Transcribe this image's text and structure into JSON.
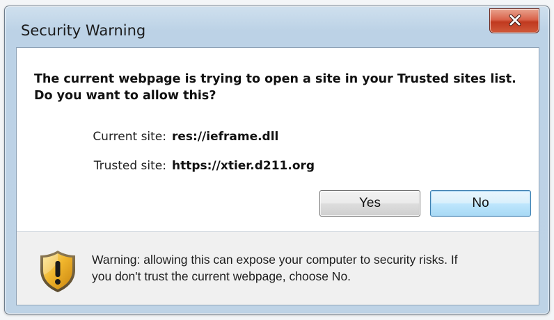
{
  "window": {
    "title": "Security Warning"
  },
  "message": {
    "line1": "The current webpage is trying to open a site in your Trusted sites list.",
    "line2": "Do you want to allow this?"
  },
  "sites": {
    "current_label": "Current site:",
    "current_value": "res://ieframe.dll",
    "trusted_label": "Trusted site:",
    "trusted_value": "https://xtier.d211.org"
  },
  "buttons": {
    "yes_label": "Yes",
    "no_label": "No",
    "default": "No"
  },
  "warning": {
    "icon": "shield-warning-icon",
    "line1": "Warning: allowing this can expose your computer to security risks. If",
    "line2": "you don't trust the current webpage, choose No."
  },
  "colors": {
    "close_button": "#c8452b",
    "default_button_border": "#3c7fb1",
    "shield_gold": "#e0a020"
  }
}
